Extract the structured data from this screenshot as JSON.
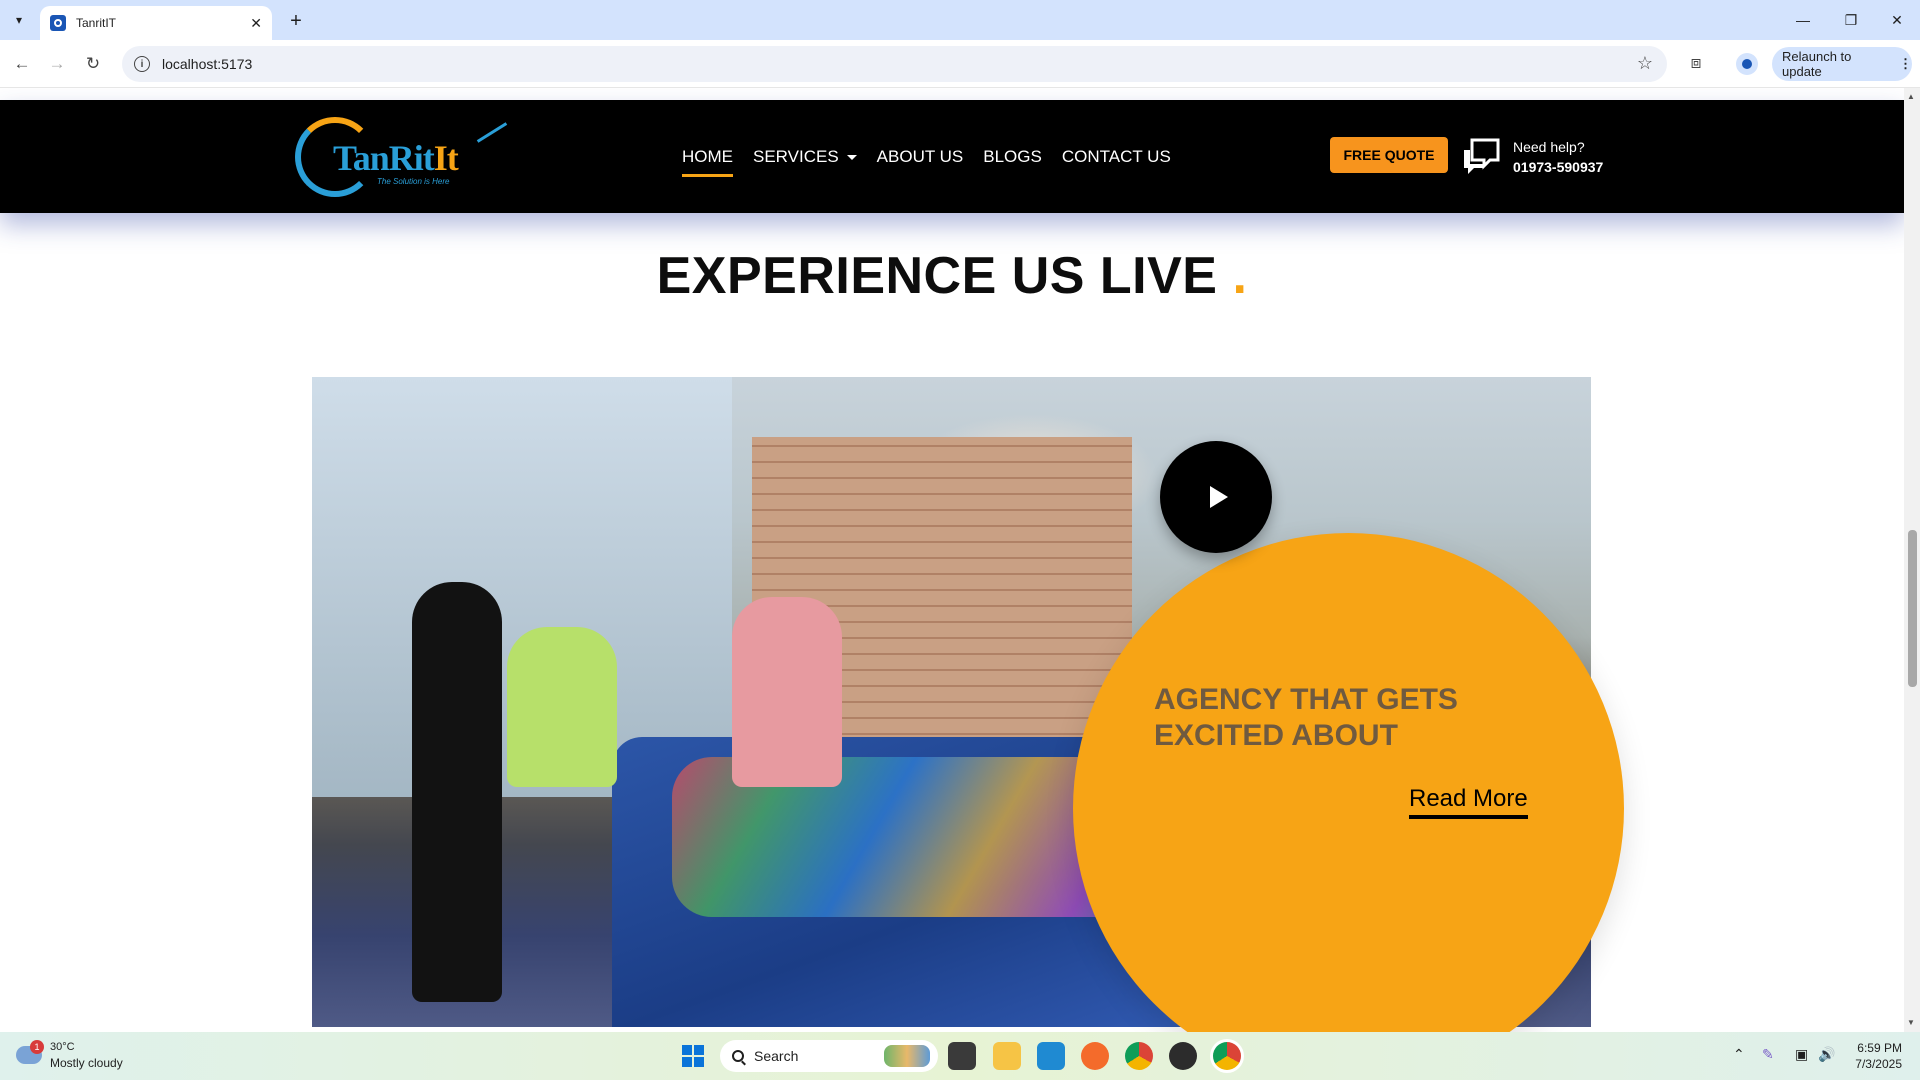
{
  "browser": {
    "tab_title": "TanritIT",
    "url": "localhost:5173",
    "relaunch_label": "Relaunch to update"
  },
  "site": {
    "brand_word_1": "TanRit",
    "brand_word_2": "It",
    "brand_tagline": "The Solution is Here",
    "nav": [
      {
        "label": "HOME",
        "active": true
      },
      {
        "label": "SERVICES",
        "dropdown": true
      },
      {
        "label": "ABOUT US"
      },
      {
        "label": "BLOGS"
      },
      {
        "label": "CONTACT US"
      }
    ],
    "quote_button": "FREE QUOTE",
    "help_label": "Need help?",
    "help_phone": "01973-590937",
    "section_title": "EXPERIENCE US LIVE",
    "section_title_dot": ".",
    "card_heading_line1": "AGENCY THAT GETS",
    "card_heading_line2": "EXCITED ABOUT",
    "read_more": "Read More"
  },
  "taskbar": {
    "weather_badge": "1",
    "temperature": "30°C",
    "condition": "Mostly cloudy",
    "search_placeholder": "Search",
    "time": "6:59 PM",
    "date": "7/3/2025"
  },
  "colors": {
    "accent_orange": "#f7a415",
    "header_bg": "#000000",
    "brand_blue": "#2a9fd8"
  }
}
